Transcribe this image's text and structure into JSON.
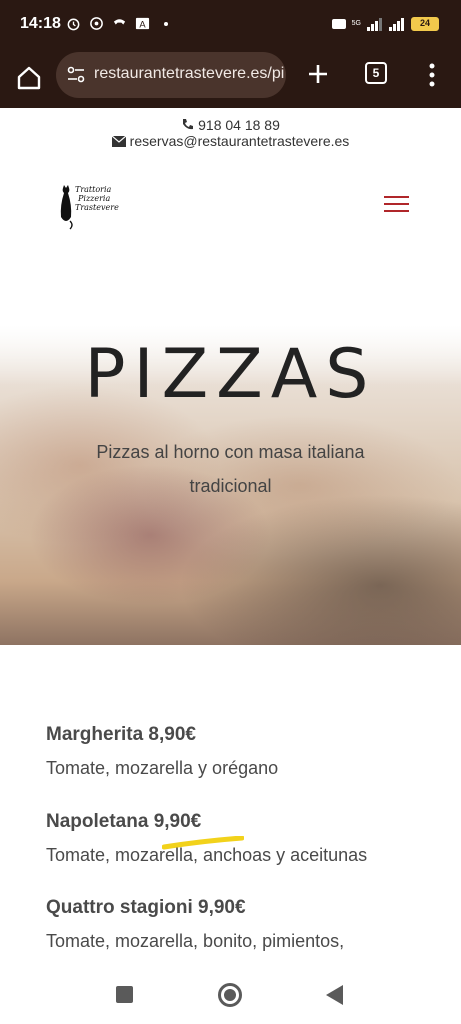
{
  "status_bar": {
    "time": "14:18",
    "network": "5G",
    "battery": "24"
  },
  "browser": {
    "url": "restaurantetrastevere.es/pizzas",
    "tab_count": "5"
  },
  "contact": {
    "phone": "918 04 18 89",
    "email": "reservas@restaurantetrastevere.es"
  },
  "logo": {
    "line1": "Trattoria",
    "line2": "Pizzeria",
    "line3": "Trastevere"
  },
  "hero": {
    "title": "PIZZAS",
    "subtitle": "Pizzas al horno con masa italiana tradicional"
  },
  "menu": {
    "items": [
      {
        "title": "Margherita 8,90€",
        "description": "Tomate, mozarella y orégano"
      },
      {
        "title": "Napoletana 9,90€",
        "description": "Tomate, mozarella, anchoas y aceitunas"
      },
      {
        "title": "Quattro stagioni 9,90€",
        "description": "Tomate, mozarella, bonito, pimientos,"
      }
    ]
  },
  "colors": {
    "brand_dark": "#2a1812",
    "hamburger": "#b0262a",
    "highlight": "#f2d21b"
  }
}
